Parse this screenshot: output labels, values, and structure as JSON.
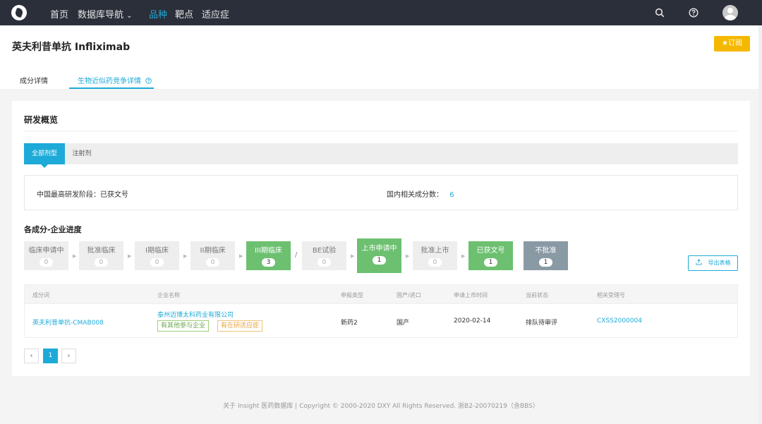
{
  "nav": {
    "items": [
      "首页",
      "数据库导航",
      "品种",
      "靶点",
      "适应症"
    ],
    "dropdown_caret": "⌄"
  },
  "header": {
    "title": "英夫利昔单抗 Infliximab",
    "subscribe_label": "订阅",
    "tabs": [
      "成分详情",
      "生物近似药竞争详情"
    ]
  },
  "overview": {
    "title": "研发概览",
    "dosage_tabs": [
      "全部剂型",
      "注射剂"
    ],
    "highest_stage_label": "中国最高研发阶段：已获文号",
    "related_count_label": "国内相关成分数：",
    "related_count": "6"
  },
  "progress": {
    "title": "各成分-企业进度",
    "stages": [
      {
        "label": "临床申请中",
        "count": "0"
      },
      {
        "label": "批准临床",
        "count": "0"
      },
      {
        "label": "I期临床",
        "count": "0"
      },
      {
        "label": "II期临床",
        "count": "0"
      },
      {
        "label": "III期临床",
        "count": "3"
      },
      {
        "label": "BE试验",
        "count": "0"
      },
      {
        "label": "上市申请中",
        "count": "1"
      },
      {
        "label": "批准上市",
        "count": "0"
      },
      {
        "label": "已获文号",
        "count": "1"
      },
      {
        "label": "不批准",
        "count": "1"
      }
    ],
    "separator": "/",
    "export_label": "导出表格"
  },
  "table": {
    "columns": [
      "成分词",
      "企业名称",
      "申报类型",
      "国产/进口",
      "申请上市时间",
      "当前状态",
      "相关受理号"
    ],
    "rows": [
      {
        "ingredient": "英夫利昔单抗-CMAB008",
        "company": "泰州迈博太科药业有限公司",
        "tags": [
          "有其他参与企业",
          "有在研适应症"
        ],
        "type": "新药2",
        "origin": "国产",
        "date": "2020-02-14",
        "status": "排队待审评",
        "accept_no": "CXSS2000004"
      }
    ]
  },
  "pagination": {
    "prev": "‹",
    "current": "1",
    "next": "›"
  },
  "footer": {
    "text": "关于 Insight 医药数据库  |  Copyright © 2000-2020 DXY All Rights Reserved. 浙B2-20070219（含BBS）"
  },
  "colors": {
    "accent": "#1eaad8",
    "nav_bg": "#2b2f3a",
    "subscribe": "#f5b800",
    "stage_green": "#6cc070",
    "stage_slate": "#8a9aa5"
  }
}
